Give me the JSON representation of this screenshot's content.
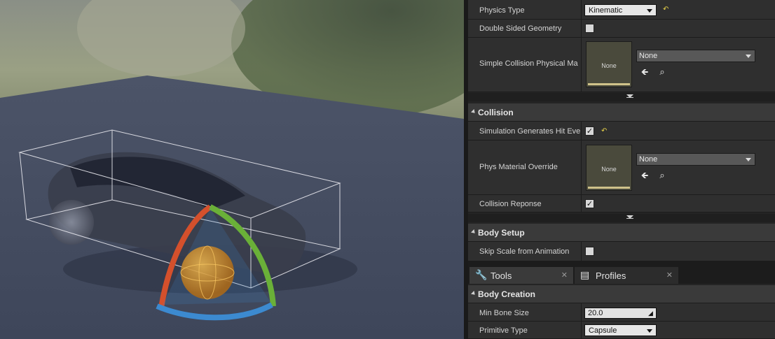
{
  "details": {
    "physics": {
      "physics_type_label": "Physics Type",
      "physics_type_value": "Kinematic",
      "double_sided_label": "Double Sided Geometry",
      "simple_collision_label": "Simple Collision Physical Ma",
      "simple_collision_thumb": "None",
      "simple_collision_value": "None"
    },
    "collision": {
      "title": "Collision",
      "sim_hit_label": "Simulation Generates Hit Eve",
      "phys_override_label": "Phys Material Override",
      "phys_override_thumb": "None",
      "phys_override_value": "None",
      "collision_reponse_label": "Collision Reponse"
    },
    "body_setup": {
      "title": "Body Setup",
      "skip_scale_label": "Skip Scale from Animation"
    }
  },
  "tabs": [
    {
      "label": "Tools",
      "icon": "wrench-icon"
    },
    {
      "label": "Profiles",
      "icon": "profile-icon"
    }
  ],
  "body_creation": {
    "title": "Body Creation",
    "min_bone_label": "Min Bone Size",
    "min_bone_value": "20.0",
    "primitive_label": "Primitive Type",
    "primitive_value": "Capsule"
  },
  "checks": {
    "double_sided": false,
    "sim_hit": true,
    "collision_reponse": true,
    "skip_scale": false
  },
  "colors": {
    "panel": "#242424",
    "row": "#2f2f2f",
    "category": "#3a3a3a",
    "reset_arrow": "#e8d24a"
  }
}
